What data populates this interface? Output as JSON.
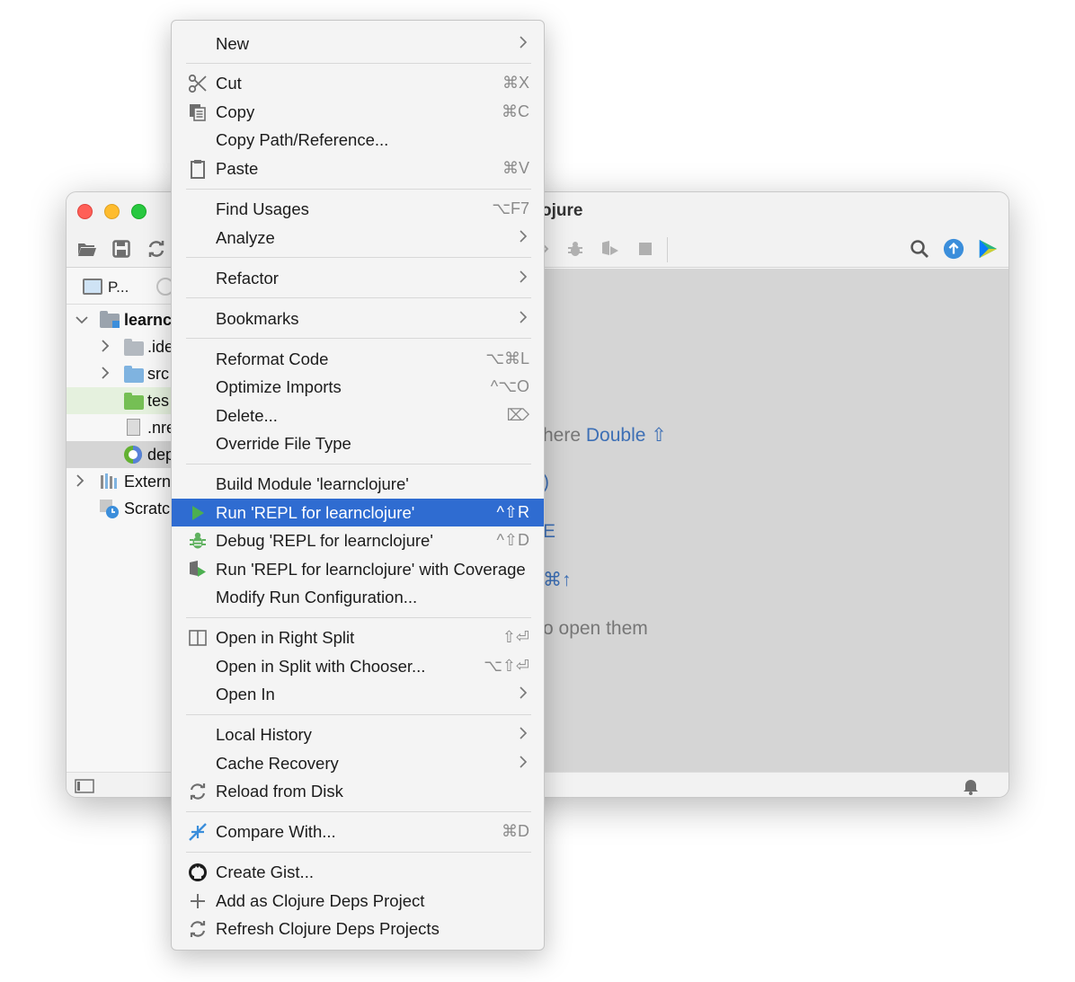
{
  "window": {
    "title": "ojure",
    "project_tab_label": "P...",
    "tree": [
      {
        "label": "learnc",
        "kind": "module"
      },
      {
        "label": ".ide",
        "kind": "folder"
      },
      {
        "label": "src",
        "kind": "folder"
      },
      {
        "label": "tes",
        "kind": "test-folder"
      },
      {
        "label": ".nre",
        "kind": "file"
      },
      {
        "label": "dep",
        "kind": "deps-file"
      },
      {
        "label": "Extern",
        "kind": "libraries"
      },
      {
        "label": "Scratc",
        "kind": "scratches"
      }
    ],
    "editor_hints": {
      "line1_prefix": "here ",
      "line1_link": "Double",
      "line1_key": "⇧",
      "line2": ")",
      "line3": "E",
      "line4": "⌘↑",
      "line5": "o open them"
    }
  },
  "menu": {
    "items": [
      {
        "label": "New",
        "shortcut": "",
        "submenu": true,
        "icon": ""
      },
      {
        "label": "Cut",
        "shortcut": "⌘X",
        "submenu": false,
        "icon": "scissors-icon"
      },
      {
        "label": "Copy",
        "shortcut": "⌘C",
        "submenu": false,
        "icon": "copy-icon"
      },
      {
        "label": "Copy Path/Reference...",
        "shortcut": "",
        "submenu": false,
        "icon": ""
      },
      {
        "label": "Paste",
        "shortcut": "⌘V",
        "submenu": false,
        "icon": "clipboard-icon"
      },
      {
        "label": "Find Usages",
        "shortcut": "⌥F7",
        "submenu": false,
        "icon": ""
      },
      {
        "label": "Analyze",
        "shortcut": "",
        "submenu": true,
        "icon": ""
      },
      {
        "label": "Refactor",
        "shortcut": "",
        "submenu": true,
        "icon": ""
      },
      {
        "label": "Bookmarks",
        "shortcut": "",
        "submenu": true,
        "icon": ""
      },
      {
        "label": "Reformat Code",
        "shortcut": "⌥⌘L",
        "submenu": false,
        "icon": ""
      },
      {
        "label": "Optimize Imports",
        "shortcut": "^⌥O",
        "submenu": false,
        "icon": ""
      },
      {
        "label": "Delete...",
        "shortcut": "⌦",
        "submenu": false,
        "icon": ""
      },
      {
        "label": "Override File Type",
        "shortcut": "",
        "submenu": false,
        "icon": ""
      },
      {
        "label": "Build Module 'learnclojure'",
        "shortcut": "",
        "submenu": false,
        "icon": ""
      },
      {
        "label": "Run 'REPL for learnclojure'",
        "shortcut": "^⇧R",
        "submenu": false,
        "icon": "run-icon"
      },
      {
        "label": "Debug 'REPL for learnclojure'",
        "shortcut": "^⇧D",
        "submenu": false,
        "icon": "debug-icon"
      },
      {
        "label": "Run 'REPL for learnclojure' with Coverage",
        "shortcut": "",
        "submenu": false,
        "icon": "coverage-icon"
      },
      {
        "label": "Modify Run Configuration...",
        "shortcut": "",
        "submenu": false,
        "icon": ""
      },
      {
        "label": "Open in Right Split",
        "shortcut": "⇧⏎",
        "submenu": false,
        "icon": "split-icon"
      },
      {
        "label": "Open in Split with Chooser...",
        "shortcut": "⌥⇧⏎",
        "submenu": false,
        "icon": ""
      },
      {
        "label": "Open In",
        "shortcut": "",
        "submenu": true,
        "icon": ""
      },
      {
        "label": "Local History",
        "shortcut": "",
        "submenu": true,
        "icon": ""
      },
      {
        "label": "Cache Recovery",
        "shortcut": "",
        "submenu": true,
        "icon": ""
      },
      {
        "label": "Reload from Disk",
        "shortcut": "",
        "submenu": false,
        "icon": "reload-icon"
      },
      {
        "label": "Compare With...",
        "shortcut": "⌘D",
        "submenu": false,
        "icon": "compare-icon"
      },
      {
        "label": "Create Gist...",
        "shortcut": "",
        "submenu": false,
        "icon": "github-icon"
      },
      {
        "label": "Add as Clojure Deps Project",
        "shortcut": "",
        "submenu": false,
        "icon": "plus-icon"
      },
      {
        "label": "Refresh Clojure Deps Projects",
        "shortcut": "",
        "submenu": false,
        "icon": "refresh-icon"
      }
    ],
    "highlighted_item": "Run 'REPL for learnclojure'"
  },
  "colors": {
    "highlight": "#2f6cd1",
    "run_green": "#4caf50",
    "link_blue": "#3d6fb5",
    "folder_blue": "#7fb3e0",
    "folder_green": "#75bf54"
  }
}
